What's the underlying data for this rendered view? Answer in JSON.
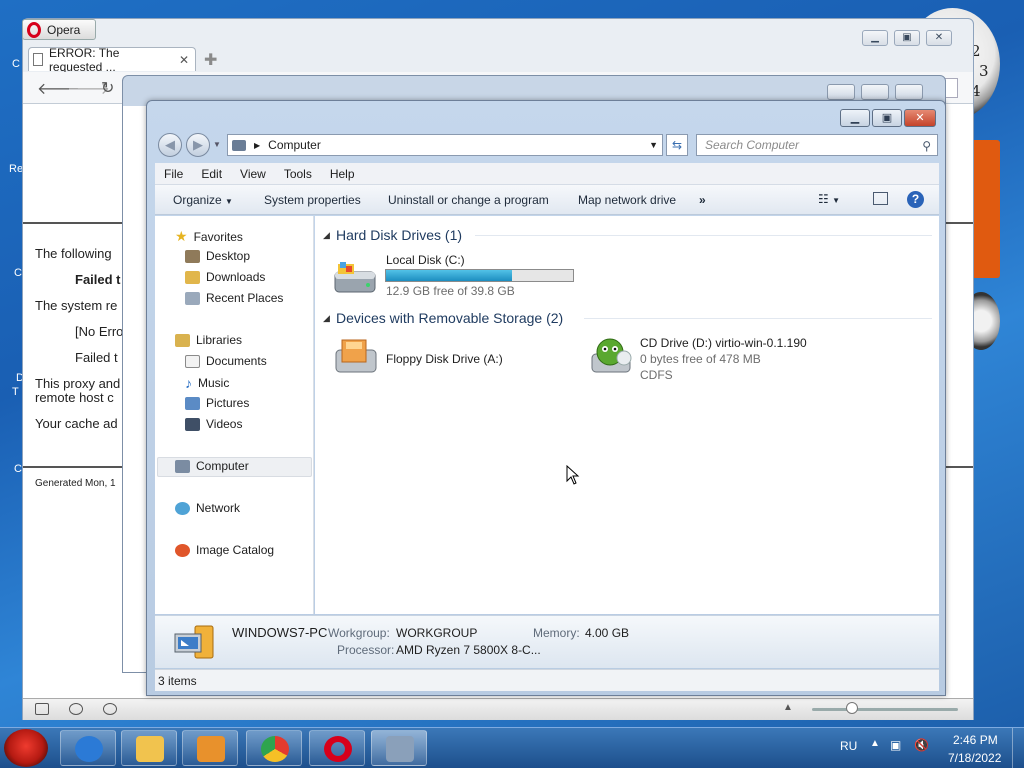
{
  "desktop": {
    "clock_numbers": [
      "2",
      "3",
      "4"
    ],
    "edge_labels": [
      "C",
      "Re",
      "C",
      "D",
      "T",
      "C"
    ]
  },
  "opera": {
    "app_name": "Opera",
    "tab_title": "ERROR: The requested ...",
    "page_lines": [
      "The following",
      "Failed t",
      "The system re",
      "[No Erro",
      "Failed t",
      "This proxy and",
      "remote host c",
      "Your cache ad",
      "Generated Mon, 1"
    ]
  },
  "explorer": {
    "window": {
      "min": "▁",
      "max": "▣",
      "close": "✕"
    },
    "address": {
      "breadcrumb": "Computer"
    },
    "search": {
      "placeholder": "Search Computer"
    },
    "menu": [
      "File",
      "Edit",
      "View",
      "Tools",
      "Help"
    ],
    "commands": {
      "organize": "Organize",
      "system_properties": "System properties",
      "uninstall": "Uninstall or change a program",
      "map_drive": "Map network drive",
      "more": "»"
    },
    "nav": {
      "favorites": "Favorites",
      "desktop": "Desktop",
      "downloads": "Downloads",
      "recent": "Recent Places",
      "libraries": "Libraries",
      "documents": "Documents",
      "music": "Music",
      "pictures": "Pictures",
      "videos": "Videos",
      "computer": "Computer",
      "network": "Network",
      "image_catalog": "Image Catalog"
    },
    "groups": {
      "hdd_header": "Hard Disk Drives (1)",
      "removable_header": "Devices with Removable Storage (2)"
    },
    "drives": {
      "local": {
        "name": "Local Disk (C:)",
        "free": "12.9 GB free of 39.8 GB",
        "used_fraction": 0.676
      },
      "floppy": {
        "name": "Floppy Disk Drive (A:)"
      },
      "cd": {
        "name": "CD Drive (D:) virtio-win-0.1.190",
        "free": "0 bytes free of 478 MB",
        "fs": "CDFS"
      }
    },
    "details": {
      "computer_name": "WINDOWS7-PC",
      "workgroup_label": "Workgroup:",
      "workgroup": "WORKGROUP",
      "memory_label": "Memory:",
      "memory": "4.00 GB",
      "processor_label": "Processor:",
      "processor": "AMD Ryzen 7 5800X 8-C..."
    },
    "status": "3 items"
  },
  "taskbar": {
    "language": "RU",
    "time": "2:46 PM",
    "date": "7/18/2022"
  }
}
